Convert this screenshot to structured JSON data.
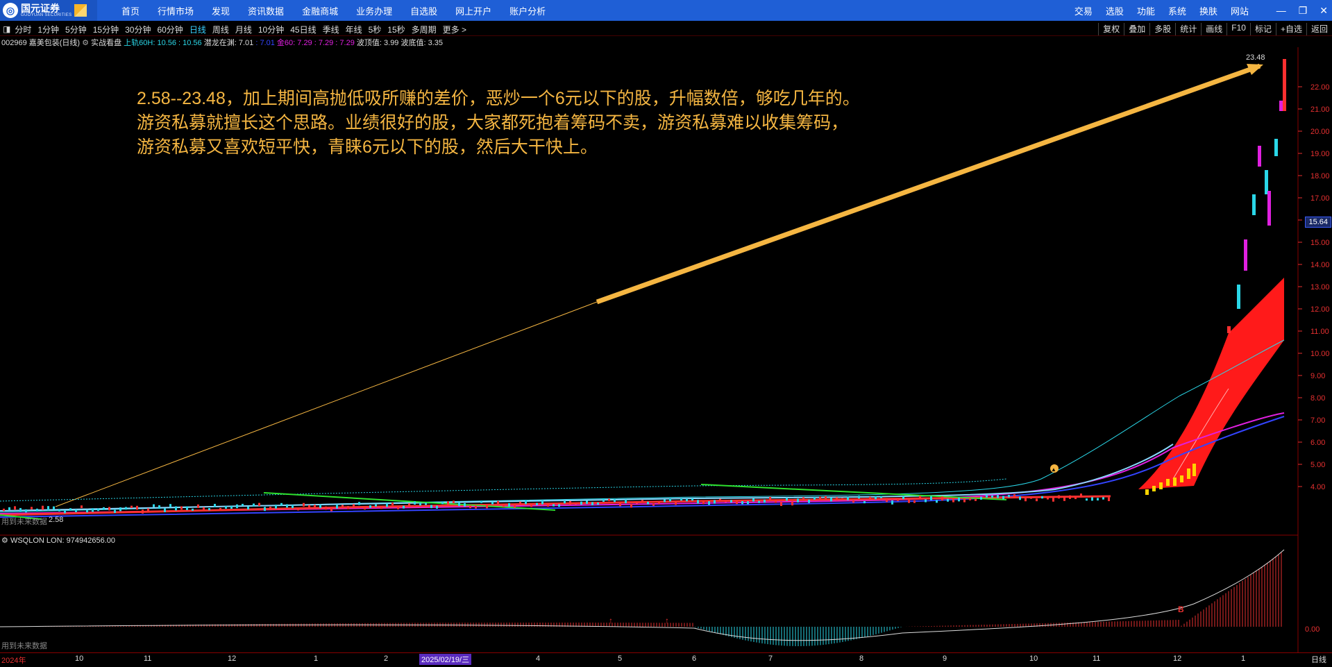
{
  "app": {
    "brand_cn": "国元证券",
    "brand_en": "GUOYUAN SECURITIES",
    "nav": [
      "首页",
      "行情市场",
      "发现",
      "资讯数据",
      "金融商城",
      "业务办理",
      "自选股",
      "网上开户",
      "账户分析"
    ],
    "right_nav": [
      "交易",
      "选股",
      "功能",
      "系统",
      "换肤",
      "网站"
    ],
    "win_controls": [
      "—",
      "❐",
      "✕"
    ]
  },
  "toolbar": {
    "timeframes": [
      "分时",
      "1分钟",
      "5分钟",
      "15分钟",
      "30分钟",
      "60分钟",
      "日线",
      "周线",
      "月线",
      "10分钟",
      "45日线",
      "季线",
      "年线",
      "5秒",
      "15秒",
      "多周期",
      "更多 >"
    ],
    "active": "日线",
    "right_buttons": [
      "复权",
      "叠加",
      "多股",
      "统计",
      "画线",
      "F10",
      "标记",
      "+自选",
      "返回"
    ]
  },
  "info": {
    "stock": "002969 嘉美包装(日线)",
    "mode": "实战看盘",
    "ind1": "上轨60H: 10.56 : 10.56",
    "ind2": "潜龙在渊: 7.01",
    "ind2b": ": 7.01",
    "ind3": "金60: 7.29 : 7.29 : 7.29",
    "ind4": "波顶值: 3.99 波底值: 3.35"
  },
  "annotation": {
    "line1": "2.58--23.48，加上期间高抛低吸所赚的差价，恶炒一个6元以下的股，升幅数倍，够吃几年的。",
    "line2": "游资私募就擅长这个思路。业绩很好的股，大家都死抱着筹码不卖，游资私募难以收集筹码，",
    "line3": "游资私募又喜欢短平快，青睐6元以下的股，然后大干快上。"
  },
  "price_axis": [
    "22.00",
    "21.00",
    "20.00",
    "19.00",
    "18.00",
    "17.00",
    "16.00",
    "15.00",
    "14.00",
    "13.00",
    "12.00",
    "11.00",
    "10.00",
    "9.00",
    "8.00",
    "7.00",
    "6.00",
    "5.00",
    "4.00"
  ],
  "current_price": "15.64",
  "high_label": "23.48",
  "low_label": "2.58",
  "future_data": "用到未来数据",
  "indicator": {
    "name": "WSQLON",
    "value": "LON: 974942656.00",
    "zero": "0.00"
  },
  "dates": {
    "year": "2024年",
    "months": [
      "10",
      "11",
      "12",
      "1",
      "2",
      "4",
      "5",
      "6",
      "7",
      "8",
      "9",
      "10",
      "11",
      "12",
      "1"
    ],
    "cursor": "2025/02/19/三",
    "period": "日线"
  },
  "colors": {
    "accent": "#1f5fd6",
    "annotation": "#f5b642",
    "up": "#e63030",
    "cyan": "#2ad7e8",
    "magenta": "#e020e0"
  }
}
